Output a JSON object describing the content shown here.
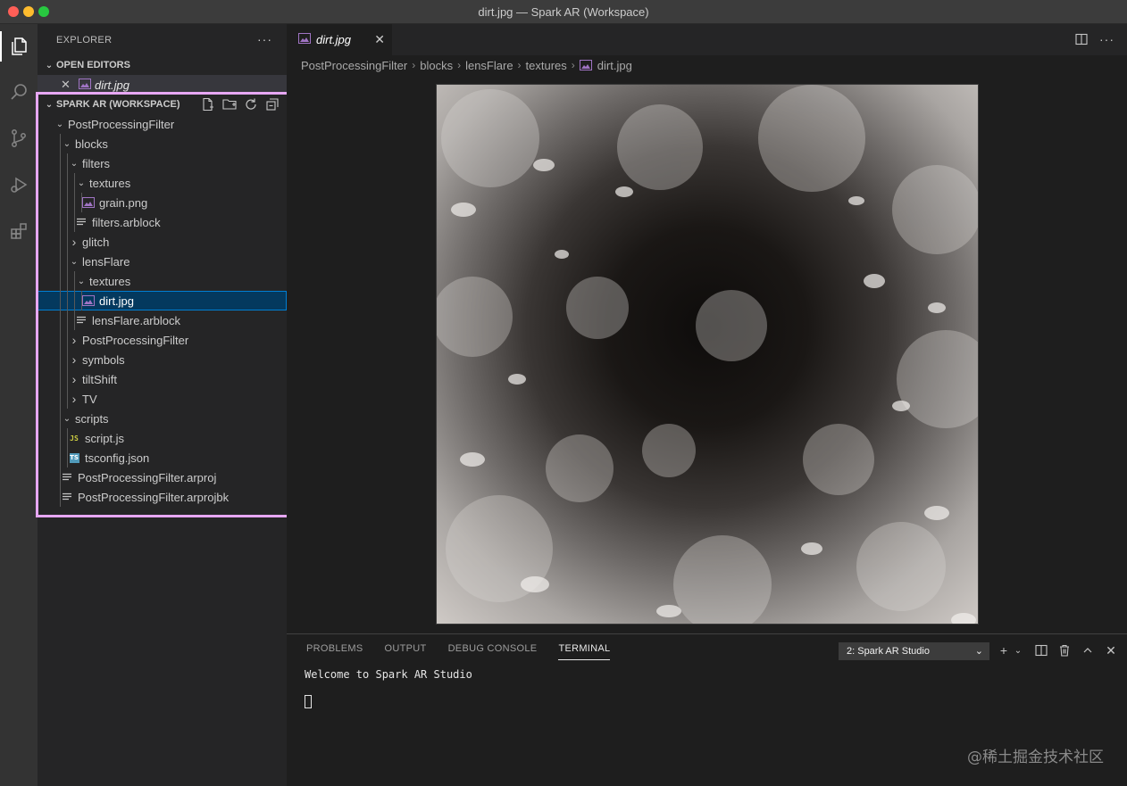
{
  "window": {
    "title": "dirt.jpg — Spark AR (Workspace)"
  },
  "sidebar": {
    "header": "EXPLORER",
    "more": "···",
    "open_editors": {
      "title": "OPEN EDITORS",
      "items": [
        {
          "label": "dirt.jpg"
        }
      ]
    },
    "workspace": {
      "title": "SPARK AR (WORKSPACE)",
      "tree": [
        {
          "label": "PostProcessingFilter",
          "type": "folder",
          "expanded": true
        },
        {
          "label": "blocks",
          "type": "folder",
          "expanded": true
        },
        {
          "label": "filters",
          "type": "folder",
          "expanded": true
        },
        {
          "label": "textures",
          "type": "folder",
          "expanded": true
        },
        {
          "label": "grain.png",
          "type": "image"
        },
        {
          "label": "filters.arblock",
          "type": "text"
        },
        {
          "label": "glitch",
          "type": "folder",
          "expanded": false
        },
        {
          "label": "lensFlare",
          "type": "folder",
          "expanded": true
        },
        {
          "label": "textures",
          "type": "folder",
          "expanded": true
        },
        {
          "label": "dirt.jpg",
          "type": "image",
          "selected": true
        },
        {
          "label": "lensFlare.arblock",
          "type": "text"
        },
        {
          "label": "PostProcessingFilter",
          "type": "folder",
          "expanded": false
        },
        {
          "label": "symbols",
          "type": "folder",
          "expanded": false
        },
        {
          "label": "tiltShift",
          "type": "folder",
          "expanded": false
        },
        {
          "label": "TV",
          "type": "folder",
          "expanded": false
        },
        {
          "label": "scripts",
          "type": "folder",
          "expanded": true
        },
        {
          "label": "script.js",
          "type": "js"
        },
        {
          "label": "tsconfig.json",
          "type": "ts"
        },
        {
          "label": "PostProcessingFilter.arproj",
          "type": "text"
        },
        {
          "label": "PostProcessingFilter.arprojbk",
          "type": "text"
        }
      ]
    }
  },
  "editor": {
    "tab": {
      "label": "dirt.jpg"
    },
    "breadcrumbs": [
      "PostProcessingFilter",
      "blocks",
      "lensFlare",
      "textures",
      "dirt.jpg"
    ]
  },
  "panel": {
    "tabs": [
      "PROBLEMS",
      "OUTPUT",
      "DEBUG CONSOLE",
      "TERMINAL"
    ],
    "active_tab": "TERMINAL",
    "terminal_select": "2: Spark AR Studio",
    "terminal_output": "Welcome to Spark AR Studio"
  },
  "watermark": "@稀土掘金技术社区",
  "colors": {
    "selection": "#04395e",
    "selection_border": "#007fd4",
    "highlight_box": "#e7a7f4",
    "image_icon": "#a074c4",
    "js_icon": "#cbcb41",
    "ts_icon": "#519aba"
  }
}
